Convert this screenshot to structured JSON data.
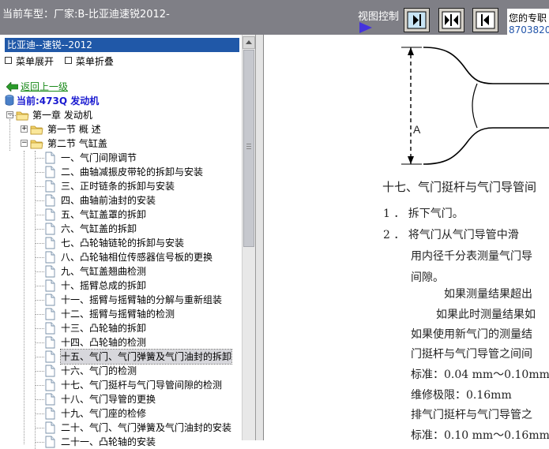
{
  "header": {
    "car_title": "当前车型：厂家:B-比亚迪速锐2012-",
    "view_control_label": "视图控制",
    "copyright_text": "您的专职",
    "copyright_phone": "8703820",
    "buttons": [
      {
        "icon": "arrow-right-bar-icon"
      },
      {
        "icon": "split-arrows-icon"
      },
      {
        "icon": "arrow-left-bar-icon"
      }
    ]
  },
  "panel": {
    "title": "比亚迪--速锐--2012",
    "menu_expand": "菜单展开",
    "menu_collapse": "菜单折叠",
    "back_link": "返回上一级",
    "current": "当前:473Q 发动机"
  },
  "tree": {
    "chapter": "第一章 发动机",
    "section1": "第一节 概 述",
    "section2": "第二节 气缸盖",
    "items": [
      "一、气门间隙调节",
      "二、曲轴减振皮带轮的拆卸与安装",
      "三、正时链条的拆卸与安装",
      "四、曲轴前油封的安装",
      "五、气缸盖罩的拆卸",
      "六、气缸盖的拆卸",
      "七、凸轮轴链轮的拆卸与安装",
      "八、凸轮轴相位传感器信号板的更换",
      "九、气缸盖翘曲检测",
      "十、摇臂总成的拆卸",
      "十一、摇臂与摇臂轴的分解与重新组装",
      "十二、摇臂与摇臂轴的检测",
      "十三、凸轮轴的拆卸",
      "十四、凸轮轴的检测",
      "十五、气门、气门弹簧及气门油封的拆卸",
      "十六、气门的检测",
      "十七、气门挺杆与气门导管间隙的检测",
      "十八、气门导管的更换",
      "十九、气门座的检修",
      "二十、气门、气门弹簧及气门油封的安装",
      "二十一、凸轮轴的安装"
    ],
    "selected_index": 14
  },
  "document": {
    "figure_label": "A",
    "lines": [
      "十七、气门挺杆与气门导管间",
      "1 ． 拆下气门。",
      "2 ． 将气门从气门导管中滑",
      "用内径千分表测量气门导",
      "间隙。",
      "如果测量结果超出",
      "如果此时测量结果如",
      "如果使用新气门的测量结",
      "门挺杆与气门导管之间间",
      "标准：0.04 mm～0.10mm",
      "维修极限：0.16mm",
      "排气门挺杆与气门导管之",
      "标准：0.10 mm～0.16mm"
    ]
  }
}
